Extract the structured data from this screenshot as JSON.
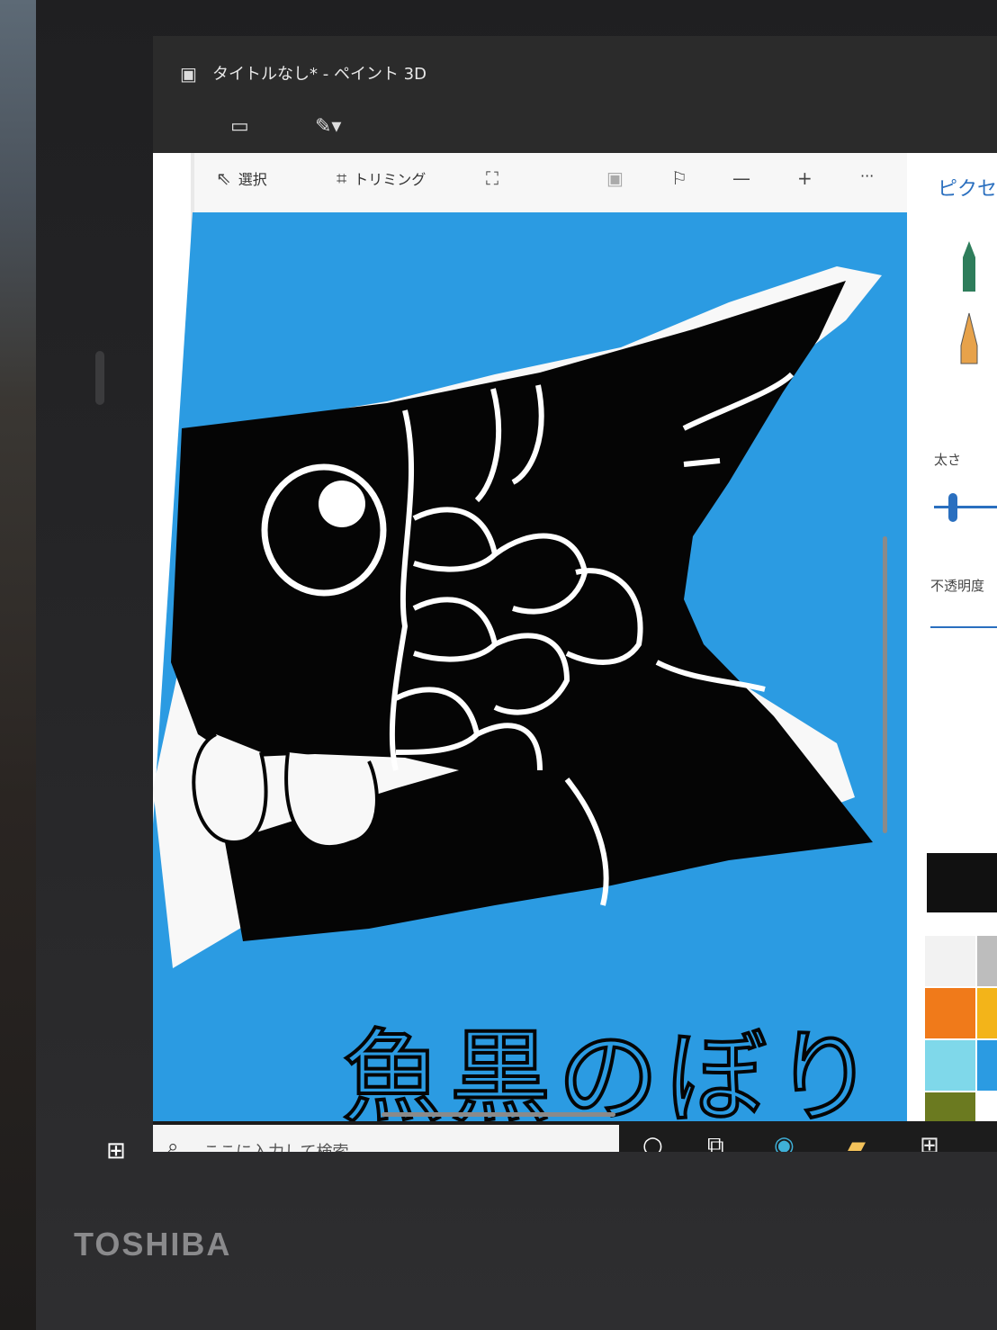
{
  "window": {
    "title": "タイトルなし* - ペイント 3D"
  },
  "toolbar": {
    "select_label": "選択",
    "crop_label": "トリミング",
    "more_label": "···"
  },
  "side_panel": {
    "title": "ピクセ",
    "size_label": "太さ",
    "opacity_label": "不透明度"
  },
  "canvas": {
    "handwritten_text": "魚黒のぼり"
  },
  "taskbar": {
    "search_placeholder": "ここに入力して検索"
  },
  "bezel": {
    "brand": "TOSHIBA"
  },
  "colors": {
    "canvas_sky": "#2b9be2",
    "fish_body": "#050505",
    "outline": "#ffffff",
    "accent_blue": "#2a6fbf",
    "palette": [
      "#f2f2f2",
      "#bdbdbd",
      "#f07a1a",
      "#f3b419",
      "#7fd8ea",
      "#2b9be2",
      "#6b7a20",
      "#111111"
    ]
  }
}
